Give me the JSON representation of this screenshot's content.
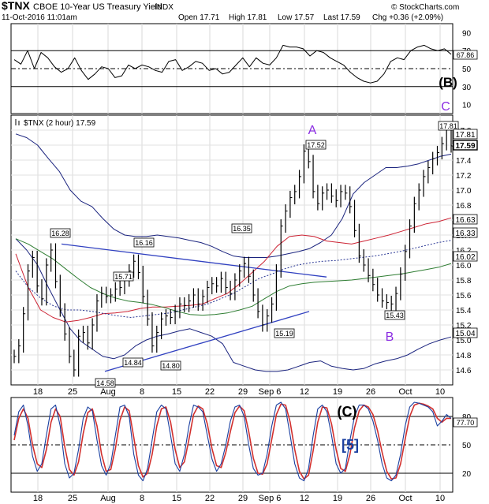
{
  "header": {
    "symbol": "$TNX",
    "title": "CBOE 10-Year US Treasury Yield",
    "exchange": "INDX",
    "timestamp": "11-Oct-2016 11:01am",
    "brand": "© StockCharts.com",
    "quote_open": "Open 17.71",
    "quote_high": "High 17.81",
    "quote_low": "Low 17.57",
    "quote_last": "Last 17.59",
    "quote_chg": "Chg +0.36 (+2.09%)"
  },
  "colors": {
    "price": "#000000",
    "bollinger": "#1a237e",
    "ma_red": "#cc2233",
    "ma_green": "#2e7d32",
    "ma_dotted": "#283593",
    "trendline": "#3040c0",
    "wave_label": "#8a2be2",
    "stoch_red": "#d2302e",
    "stoch_blue": "#1a3fa0"
  },
  "chart_data": [
    {
      "type": "line",
      "name": "RSI",
      "ylim": [
        0,
        100
      ],
      "yticks": [
        10,
        30,
        50,
        70,
        90
      ],
      "last_value": "67.86",
      "wave_label": "(B)",
      "values": [
        60,
        55,
        70,
        50,
        68,
        62,
        52,
        46,
        50,
        62,
        48,
        38,
        44,
        52,
        50,
        40,
        42,
        54,
        50,
        54,
        52,
        48,
        46,
        58,
        60,
        48,
        52,
        58,
        56,
        48,
        50,
        44,
        46,
        54,
        62,
        52,
        62,
        56,
        54,
        62,
        76,
        74,
        74,
        72,
        64,
        70,
        68,
        62,
        58,
        54,
        46,
        40,
        36,
        34,
        36,
        44,
        58,
        62,
        60,
        70,
        74,
        76,
        72,
        70,
        72,
        66
      ]
    },
    {
      "type": "line",
      "name": "$TNX (2 hour)",
      "legend": "$TNX (2 hour) 17.59",
      "ylim": [
        14.4,
        18.0
      ],
      "yticks": [
        "14.6",
        "14.8",
        "15.0",
        "15.2",
        "15.4",
        "15.6",
        "15.8",
        "16.0",
        "16.2",
        "16.4",
        "16.6",
        "16.8",
        "17.0",
        "17.2",
        "17.4",
        "17.6",
        "17.8"
      ],
      "x_labels": [
        "18",
        "25",
        "Aug",
        "8",
        "15",
        "22",
        "29",
        "Sep 6",
        "12",
        "19",
        "26",
        "Oct",
        "10"
      ],
      "price": [
        14.78,
        14.92,
        15.35,
        15.92,
        16.1,
        15.72,
        15.55,
        16.0,
        16.2,
        15.78,
        15.4,
        15.08,
        14.78,
        14.6,
        15.05,
        15.1,
        14.96,
        15.2,
        15.52,
        15.62,
        15.58,
        15.6,
        15.68,
        15.7,
        15.8,
        15.92,
        16.05,
        15.9,
        15.58,
        15.28,
        14.92,
        15.1,
        15.28,
        15.32,
        15.3,
        15.38,
        15.48,
        15.46,
        15.52,
        15.6,
        15.48,
        15.58,
        15.7,
        15.75,
        15.72,
        15.82,
        15.7,
        15.62,
        15.8,
        15.92,
        16.02,
        15.85,
        15.6,
        15.38,
        15.2,
        15.32,
        15.48,
        15.92,
        16.52,
        16.72,
        16.9,
        16.98,
        17.18,
        17.52,
        17.38,
        16.98,
        16.82,
        16.96,
        17.0,
        16.92,
        16.86,
        16.98,
        16.96,
        16.78,
        16.46,
        16.12,
        16.0,
        15.86,
        15.74,
        15.6,
        15.52,
        15.5,
        15.48,
        15.62,
        15.88,
        16.18,
        16.52,
        16.82,
        17.0,
        17.18,
        17.3,
        17.42,
        17.5,
        17.62,
        17.81,
        17.59
      ],
      "bb_upper": [
        17.75,
        17.7,
        17.6,
        17.42,
        17.25,
        17.0,
        16.85,
        16.78,
        16.62,
        16.48,
        16.4,
        16.38,
        16.38,
        16.4,
        16.38,
        16.36,
        16.33,
        16.3,
        16.25,
        16.18,
        16.12,
        16.1,
        16.1,
        16.1,
        16.12,
        16.15,
        16.18,
        16.22,
        16.3,
        16.4,
        16.62,
        16.95,
        17.1,
        17.2,
        17.3,
        17.3,
        17.32,
        17.35,
        17.4,
        17.45,
        17.48
      ],
      "bb_lower": [
        16.35,
        16.2,
        16.0,
        15.7,
        15.42,
        15.15,
        14.98,
        14.88,
        14.78,
        14.75,
        14.8,
        14.92,
        15.0,
        15.05,
        15.08,
        15.12,
        15.15,
        15.1,
        15.05,
        14.95,
        14.7,
        14.65,
        14.6,
        14.58,
        14.58,
        14.6,
        14.65,
        14.7,
        14.72,
        14.65,
        14.62,
        14.6,
        14.62,
        14.68,
        14.72,
        14.75,
        14.8,
        14.88,
        14.95,
        15.0,
        15.04
      ],
      "ma_red": [
        16.15,
        15.7,
        15.4,
        15.3,
        15.24,
        15.26,
        15.3,
        15.35,
        15.36,
        15.38,
        15.42,
        15.44,
        15.44,
        15.45,
        15.46,
        15.48,
        15.55,
        15.62,
        15.75,
        15.9,
        16.05,
        16.25,
        16.38,
        16.4,
        16.38,
        16.32,
        16.3,
        16.28,
        16.32,
        16.36,
        16.4,
        16.45,
        16.5,
        16.55,
        16.58,
        16.63
      ],
      "ma_green": [
        16.35,
        16.28,
        16.18,
        16.08,
        15.95,
        15.82,
        15.7,
        15.62,
        15.56,
        15.52,
        15.5,
        15.47,
        15.43,
        15.38,
        15.34,
        15.33,
        15.34,
        15.36,
        15.4,
        15.45,
        15.55,
        15.65,
        15.72,
        15.75,
        15.77,
        15.78,
        15.79,
        15.8,
        15.82,
        15.84,
        15.86,
        15.88,
        15.91,
        15.94,
        15.97,
        16.02
      ],
      "ma_dotted": [
        15.92,
        15.7,
        15.55,
        15.45,
        15.4,
        15.4,
        15.38,
        15.35,
        15.32,
        15.3,
        15.32,
        15.34,
        15.36,
        15.4,
        15.44,
        15.48,
        15.55,
        15.62,
        15.72,
        15.82,
        15.88,
        15.95,
        16.0,
        16.03,
        16.05,
        16.06,
        16.08,
        16.1,
        16.12,
        16.15,
        16.18,
        16.22,
        16.26,
        16.3,
        16.33
      ],
      "value_labels": [
        "16.28",
        "16.16",
        "15.71",
        "16.35",
        "14.84",
        "14.80",
        "14.58",
        "15.19",
        "17.52",
        "15.43",
        "17.81"
      ],
      "right_labels": [
        "16.63",
        "16.33",
        "16.02",
        "15.04",
        "17.59",
        "17.81"
      ],
      "wave_labels": [
        "A",
        "B",
        "C"
      ]
    },
    {
      "type": "line",
      "name": "Stochastic",
      "ylim": [
        0,
        100
      ],
      "yticks": [
        20,
        50,
        80
      ],
      "last_value": "77.70",
      "wave_labels": [
        "(C)",
        "[5]"
      ],
      "fast": [
        60,
        85,
        92,
        70,
        38,
        22,
        30,
        60,
        88,
        92,
        70,
        30,
        15,
        20,
        45,
        78,
        90,
        86,
        55,
        28,
        18,
        30,
        60,
        90,
        92,
        80,
        40,
        18,
        12,
        25,
        55,
        85,
        92,
        88,
        60,
        30,
        22,
        40,
        70,
        92,
        90,
        85,
        60,
        35,
        22,
        30,
        50,
        75,
        90,
        92,
        80,
        50,
        25,
        18,
        20,
        40,
        70,
        92,
        95,
        88,
        60,
        30,
        15,
        12,
        25,
        60,
        88,
        92,
        85,
        60,
        30,
        20,
        25,
        55,
        80,
        92,
        92,
        88,
        75,
        55,
        30,
        15,
        12,
        18,
        40,
        70,
        90,
        95,
        94,
        92,
        90,
        85,
        70,
        75,
        82,
        78
      ],
      "slow": [
        55,
        78,
        88,
        78,
        50,
        30,
        26,
        45,
        74,
        88,
        80,
        48,
        24,
        18,
        32,
        62,
        84,
        88,
        70,
        40,
        22,
        24,
        46,
        76,
        90,
        86,
        58,
        28,
        16,
        20,
        40,
        70,
        88,
        90,
        74,
        45,
        26,
        32,
        56,
        82,
        91,
        88,
        72,
        46,
        28,
        26,
        42,
        64,
        84,
        91,
        86,
        64,
        36,
        20,
        19,
        30,
        56,
        82,
        93,
        92,
        74,
        45,
        22,
        14,
        18,
        44,
        74,
        90,
        89,
        72,
        45,
        25,
        22,
        40,
        68,
        86,
        92,
        90,
        82,
        65,
        42,
        22,
        14,
        15,
        30,
        56,
        80,
        92,
        94,
        93,
        91,
        88,
        78,
        74,
        78,
        78
      ]
    }
  ]
}
